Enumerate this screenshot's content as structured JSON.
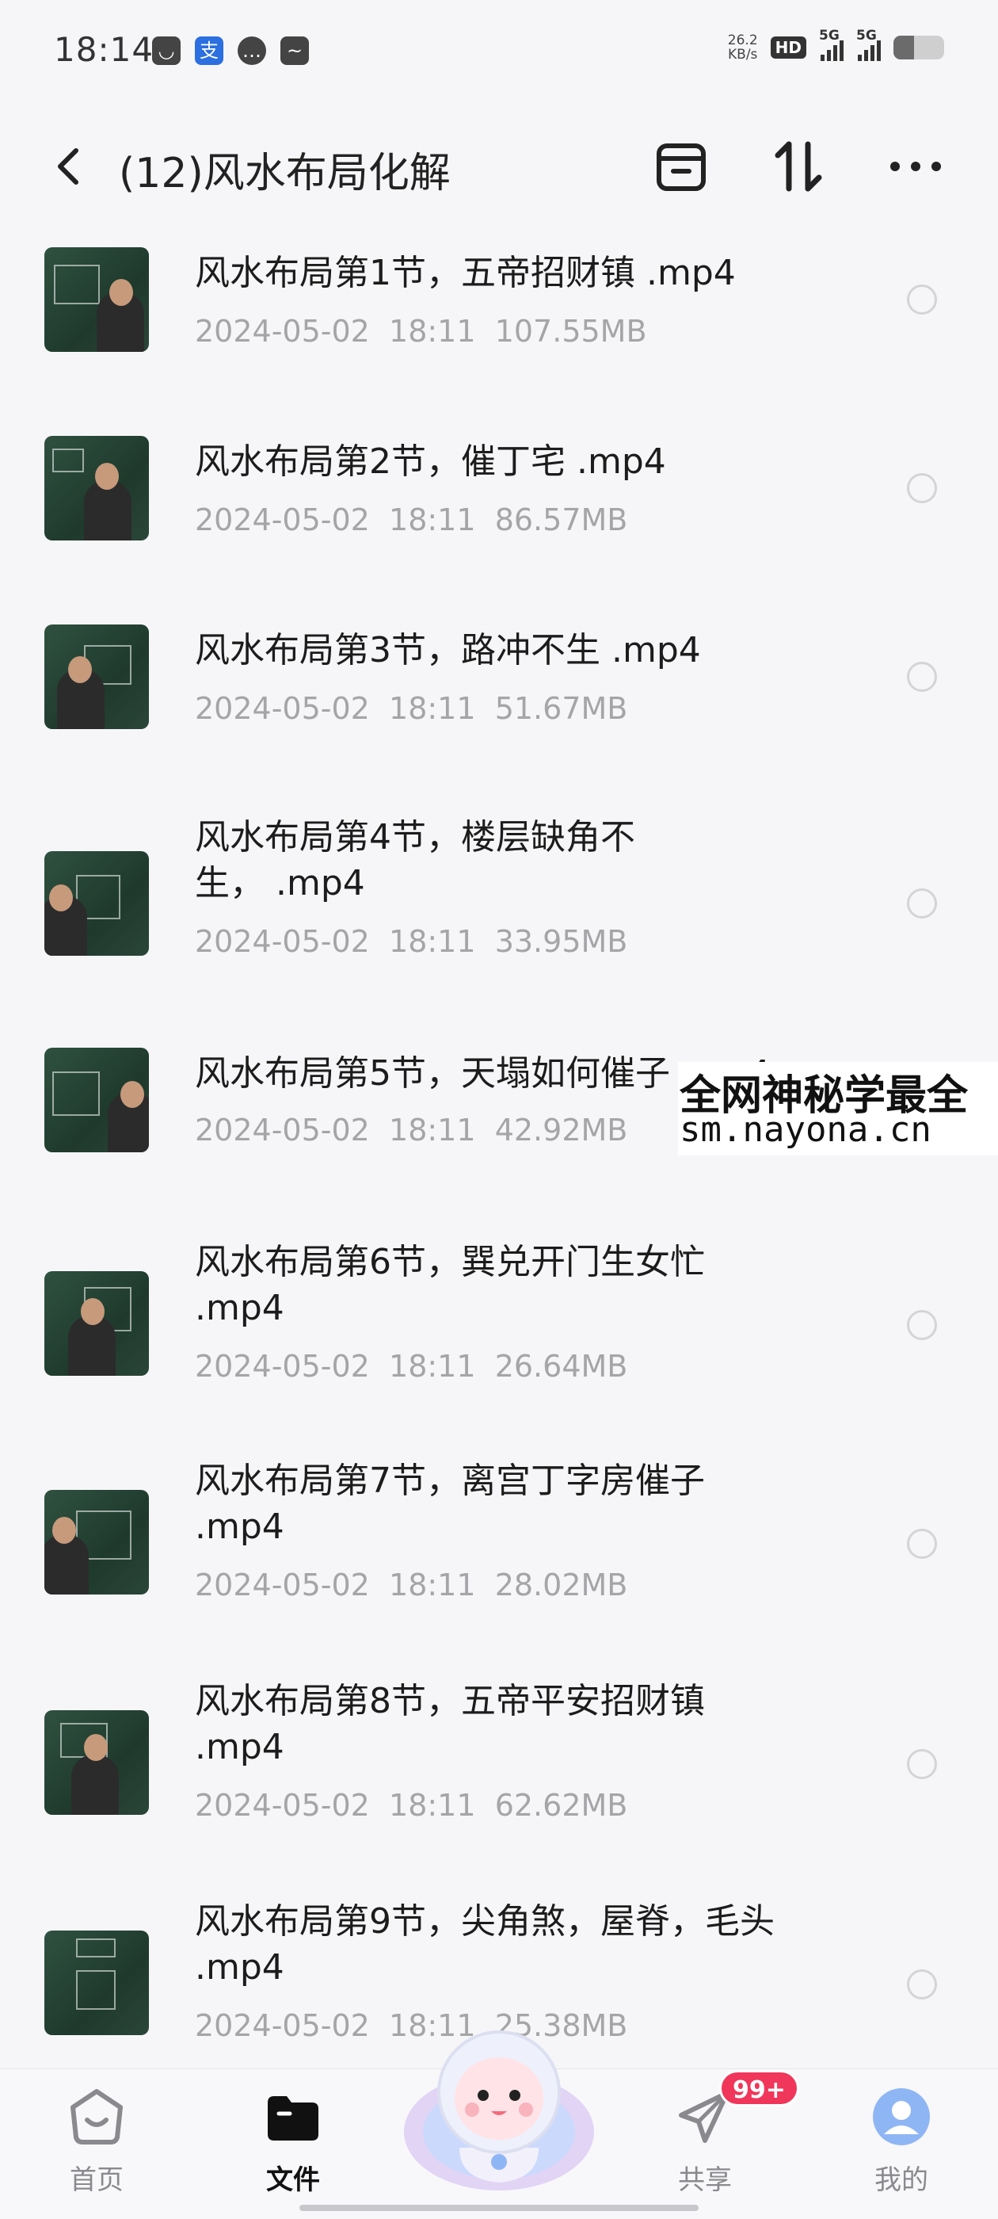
{
  "status_bar": {
    "time": "18:14",
    "net_speed_value": "26.2",
    "net_speed_unit": "KB/s",
    "hd_label": "HD",
    "signal1_label": "5G",
    "signal2_label": "5G"
  },
  "header": {
    "title": "(12)风水布局化解"
  },
  "files": [
    {
      "name": "风水布局第1节，五帝招财镇 .mp4",
      "date": "2024-05-02",
      "time": "18:11",
      "size": "107.55MB"
    },
    {
      "name": "风水布局第2节，催丁宅 .mp4",
      "date": "2024-05-02",
      "time": "18:11",
      "size": "86.57MB"
    },
    {
      "name": "风水布局第3节，路冲不生 .mp4",
      "date": "2024-05-02",
      "time": "18:11",
      "size": "51.67MB"
    },
    {
      "name": "风水布局第4节，楼层缺角不生， .mp4",
      "date": "2024-05-02",
      "time": "18:11",
      "size": "33.95MB"
    },
    {
      "name": "风水布局第5节，天塌如何催子 .mp4",
      "date": "2024-05-02",
      "time": "18:11",
      "size": "42.92MB"
    },
    {
      "name": "风水布局第6节，巽兑开门生女忙 .mp4",
      "date": "2024-05-02",
      "time": "18:11",
      "size": "26.64MB"
    },
    {
      "name": "风水布局第7节，离宫丁字房催子 .mp4",
      "date": "2024-05-02",
      "time": "18:11",
      "size": "28.02MB"
    },
    {
      "name": "风水布局第8节，五帝平安招财镇 .mp4",
      "date": "2024-05-02",
      "time": "18:11",
      "size": "62.62MB"
    },
    {
      "name": "风水布局第9节，尖角煞，屋脊，毛头 .mp4",
      "date": "2024-05-02",
      "time": "18:11",
      "size": "25.38MB"
    }
  ],
  "watermark": {
    "line1": "全网神秘学最全",
    "line2": "sm.nayona.cn"
  },
  "bottom_nav": {
    "items": [
      {
        "label": "首页",
        "icon": "home-icon"
      },
      {
        "label": "文件",
        "icon": "folder-icon"
      },
      {
        "label": "共享",
        "icon": "paper-plane-icon"
      },
      {
        "label": "我的",
        "icon": "profile-icon"
      }
    ],
    "share_badge": "99+"
  },
  "colors": {
    "background": "#f6f6f8",
    "meta_text": "#a5a5a8",
    "badge": "#f0365a"
  }
}
